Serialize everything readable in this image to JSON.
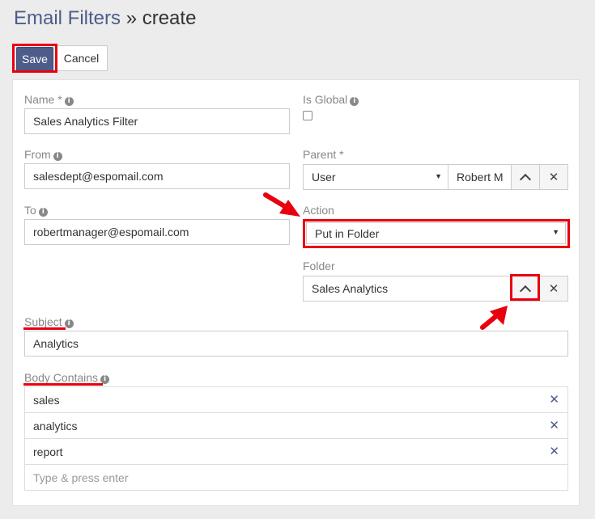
{
  "header": {
    "link": "Email Filters",
    "separator": "»",
    "page": "create"
  },
  "toolbar": {
    "save_label": "Save",
    "cancel_label": "Cancel"
  },
  "form": {
    "name": {
      "label": "Name *",
      "value": "Sales Analytics Filter"
    },
    "is_global": {
      "label": "Is Global",
      "checked": false
    },
    "from": {
      "label": "From",
      "value": "salesdept@espomail.com"
    },
    "parent": {
      "label": "Parent *",
      "type_value": "User",
      "name_value": "Robert M"
    },
    "to": {
      "label": "To",
      "value": "robertmanager@espomail.com"
    },
    "action": {
      "label": "Action",
      "value": "Put in Folder"
    },
    "folder": {
      "label": "Folder",
      "value": "Sales Analytics"
    },
    "subject": {
      "label": "Subject",
      "value": "Analytics"
    },
    "body_contains": {
      "label": "Body Contains",
      "items": [
        "sales",
        "analytics",
        "report"
      ],
      "placeholder": "Type & press enter"
    }
  },
  "colors": {
    "accent": "#4e5c8a",
    "annotation": "#e8000f"
  },
  "icons": {
    "info": "info-circle-icon",
    "select": "caret-down-icon",
    "select_btn": "chevron-up-icon",
    "clear": "close-icon"
  }
}
